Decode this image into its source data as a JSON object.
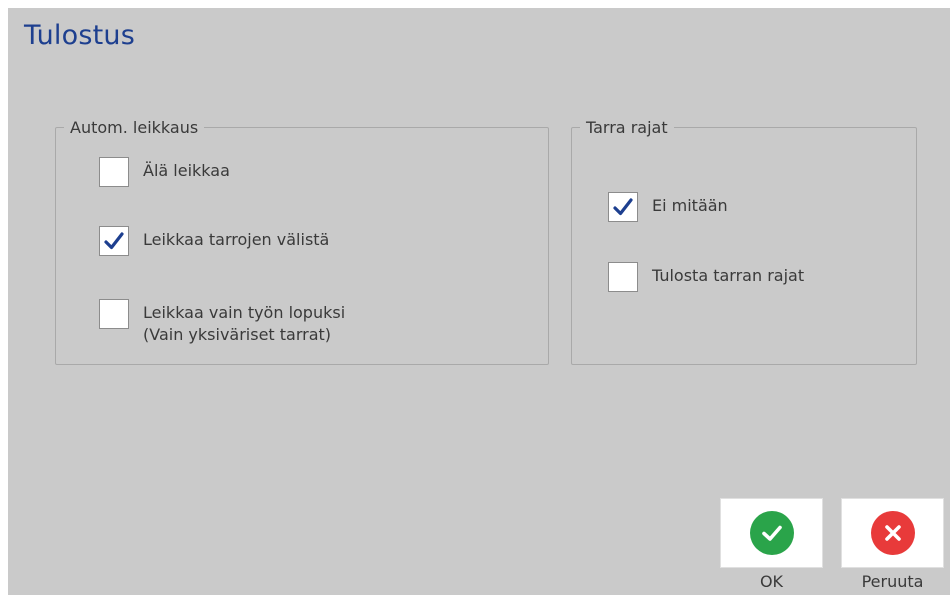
{
  "title": "Tulostus",
  "auto_cut": {
    "legend": "Autom. leikkaus",
    "options": [
      {
        "label": "Älä leikkaa",
        "checked": false
      },
      {
        "label": "Leikkaa tarrojen välistä",
        "checked": true
      },
      {
        "label": "Leikkaa vain työn lopuksi",
        "sublabel": "(Vain yksiväriset tarrat)",
        "checked": false
      }
    ]
  },
  "label_borders": {
    "legend": "Tarra rajat",
    "options": [
      {
        "label": "Ei mitään",
        "checked": true
      },
      {
        "label": "Tulosta tarran rajat",
        "checked": false
      }
    ]
  },
  "buttons": {
    "ok_label": "OK",
    "cancel_label": "Peruuta"
  },
  "colors": {
    "title": "#1d3f8f",
    "background": "#cacaca",
    "checkmark": "#1d3f8f",
    "ok": "#2aa44a",
    "cancel": "#e83a3a"
  },
  "icons": {
    "ok": "check-icon",
    "cancel": "close-icon",
    "checkbox_mark": "checkmark-icon"
  }
}
